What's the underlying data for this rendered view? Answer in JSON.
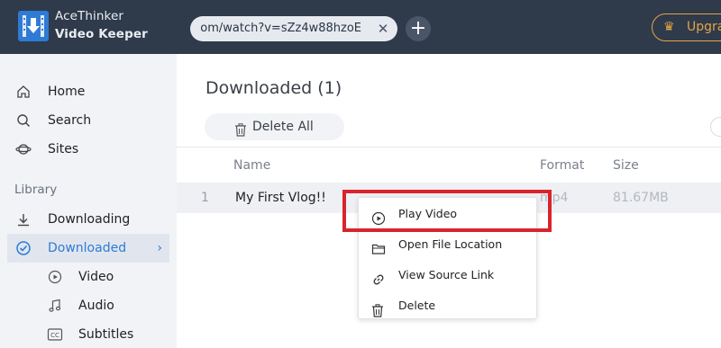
{
  "app": {
    "name_line1": "AceThinker",
    "name_line2": "Video Keeper"
  },
  "topbar": {
    "url_value": "om/watch?v=sZz4w88hzoE",
    "clear_glyph": "✕",
    "add_glyph": "+",
    "upgrade_label": "Upgrade",
    "crown_glyph": "♛"
  },
  "sidebar": {
    "home": "Home",
    "search": "Search",
    "sites": "Sites",
    "library_label": "Library",
    "downloading": "Downloading",
    "downloaded": "Downloaded",
    "chevron": "›",
    "video": "Video",
    "audio": "Audio",
    "subtitles": "Subtitles"
  },
  "main": {
    "title": "Downloaded (1)",
    "delete_all": "Delete All",
    "columns": {
      "name": "Name",
      "format": "Format",
      "size": "Size"
    },
    "rows": [
      {
        "index": "1",
        "name": "My First Vlog!!",
        "format": "mp4",
        "size": "81.67MB"
      }
    ]
  },
  "context_menu": {
    "play": "Play Video",
    "open_location": "Open File Location",
    "view_source": "View Source Link",
    "delete": "Delete"
  },
  "colors": {
    "accent": "#2e7bd6",
    "topbar": "#2f3a4b",
    "upgrade": "#e2a644",
    "highlight": "#d9242d"
  }
}
